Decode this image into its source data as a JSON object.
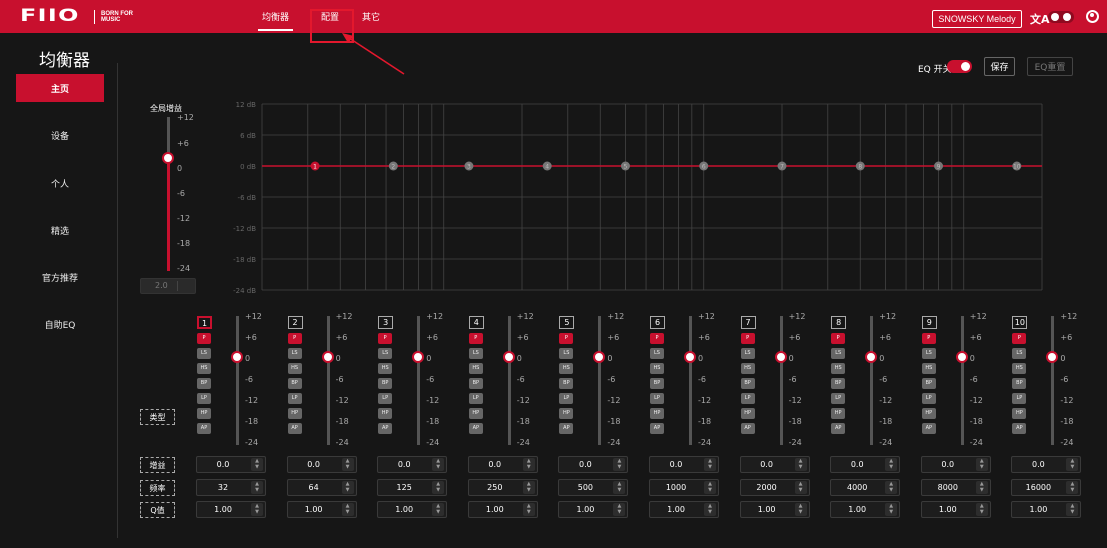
{
  "app": {
    "logo_text": "FIIO",
    "logo_tagline": "BORN FOR MUSIC",
    "tabs": [
      {
        "label": "均衡器",
        "active": true
      },
      {
        "label": "配置",
        "active": false
      },
      {
        "label": "其它",
        "active": false
      }
    ],
    "device_name": "SNOWSKY Melody",
    "language_icon": "translate-icon",
    "theme_icon": "theme-toggle-icon",
    "user_icon": "user-account-icon"
  },
  "page": {
    "title": "均衡器"
  },
  "sidebar": {
    "items": [
      {
        "label": "主页",
        "active": true
      },
      {
        "label": "设备",
        "active": false
      },
      {
        "label": "个人",
        "active": false
      },
      {
        "label": "精选",
        "active": false
      },
      {
        "label": "官方推荐",
        "active": false
      },
      {
        "label": "自助EQ",
        "active": false
      }
    ]
  },
  "controls": {
    "eq_switch_label": "EQ 开关",
    "eq_switch_on": true,
    "save_label": "保存",
    "reset_label": "EQ重置"
  },
  "global_gain": {
    "label": "全局增益",
    "value": "2.0",
    "slider_value_db": 0,
    "scale": [
      "+12",
      "+6",
      "0",
      "-6",
      "-12",
      "-18",
      "-24"
    ]
  },
  "graph": {
    "y_labels": [
      "12 dB",
      "6 dB",
      "0 dB",
      "-6 dB",
      "-12 dB",
      "-18 dB",
      "-24 dB"
    ],
    "curve_color": "#c8102e",
    "active_band": 1
  },
  "band_scale": [
    "+12",
    "+6",
    "0",
    "-6",
    "-12",
    "-18",
    "-24"
  ],
  "filter_types": [
    "P",
    "LS",
    "HS",
    "BP",
    "LP",
    "HP",
    "AP"
  ],
  "row_labels": {
    "type": "类型",
    "gain": "增益",
    "freq": "频率",
    "q": "Q值"
  },
  "bands": [
    {
      "num": "1",
      "selected": true,
      "type": "P",
      "gain": "0.0",
      "freq": "32",
      "q": "1.00"
    },
    {
      "num": "2",
      "selected": false,
      "type": "P",
      "gain": "0.0",
      "freq": "64",
      "q": "1.00"
    },
    {
      "num": "3",
      "selected": false,
      "type": "P",
      "gain": "0.0",
      "freq": "125",
      "q": "1.00"
    },
    {
      "num": "4",
      "selected": false,
      "type": "P",
      "gain": "0.0",
      "freq": "250",
      "q": "1.00"
    },
    {
      "num": "5",
      "selected": false,
      "type": "P",
      "gain": "0.0",
      "freq": "500",
      "q": "1.00"
    },
    {
      "num": "6",
      "selected": false,
      "type": "P",
      "gain": "0.0",
      "freq": "1000",
      "q": "1.00"
    },
    {
      "num": "7",
      "selected": false,
      "type": "P",
      "gain": "0.0",
      "freq": "2000",
      "q": "1.00"
    },
    {
      "num": "8",
      "selected": false,
      "type": "P",
      "gain": "0.0",
      "freq": "4000",
      "q": "1.00"
    },
    {
      "num": "9",
      "selected": false,
      "type": "P",
      "gain": "0.0",
      "freq": "8000",
      "q": "1.00"
    },
    {
      "num": "10",
      "selected": false,
      "type": "P",
      "gain": "0.0",
      "freq": "16000",
      "q": "1.00"
    }
  ],
  "colors": {
    "brand": "#c8102e",
    "background": "#161616",
    "annotation": "#e3182d"
  }
}
